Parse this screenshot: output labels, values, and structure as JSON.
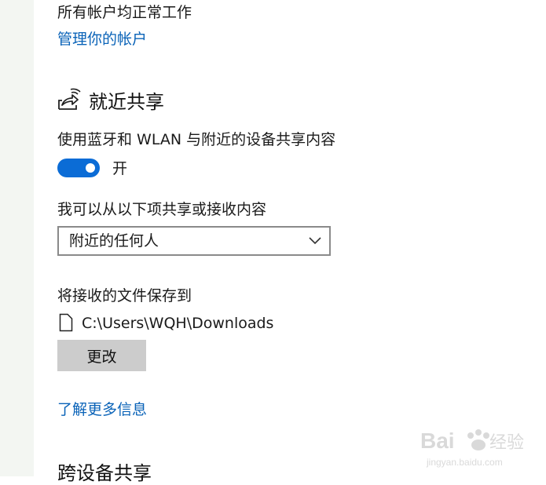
{
  "accounts": {
    "status_text": "所有帐户均正常工作",
    "manage_link": "管理你的帐户"
  },
  "nearby_sharing": {
    "title": "就近共享",
    "icon": "share-icon",
    "description": "使用蓝牙和 WLAN 与附近的设备共享内容",
    "toggle_state": "开",
    "toggle_on": true,
    "share_from_label": "我可以从以下项共享或接收内容",
    "share_from_value": "附近的任何人",
    "save_to_label": "将接收的文件保存到",
    "save_path": "C:\\Users\\WQH\\Downloads",
    "change_button": "更改",
    "learn_more_link": "了解更多信息"
  },
  "cross_device": {
    "title": "跨设备共享"
  },
  "watermark": {
    "brand": "Baidu",
    "brand_cn": "经验",
    "url": "jingyan.baidu.com"
  },
  "colors": {
    "accent": "#0b6cd6",
    "link": "#0a63b8",
    "button_bg": "#cccccc"
  }
}
